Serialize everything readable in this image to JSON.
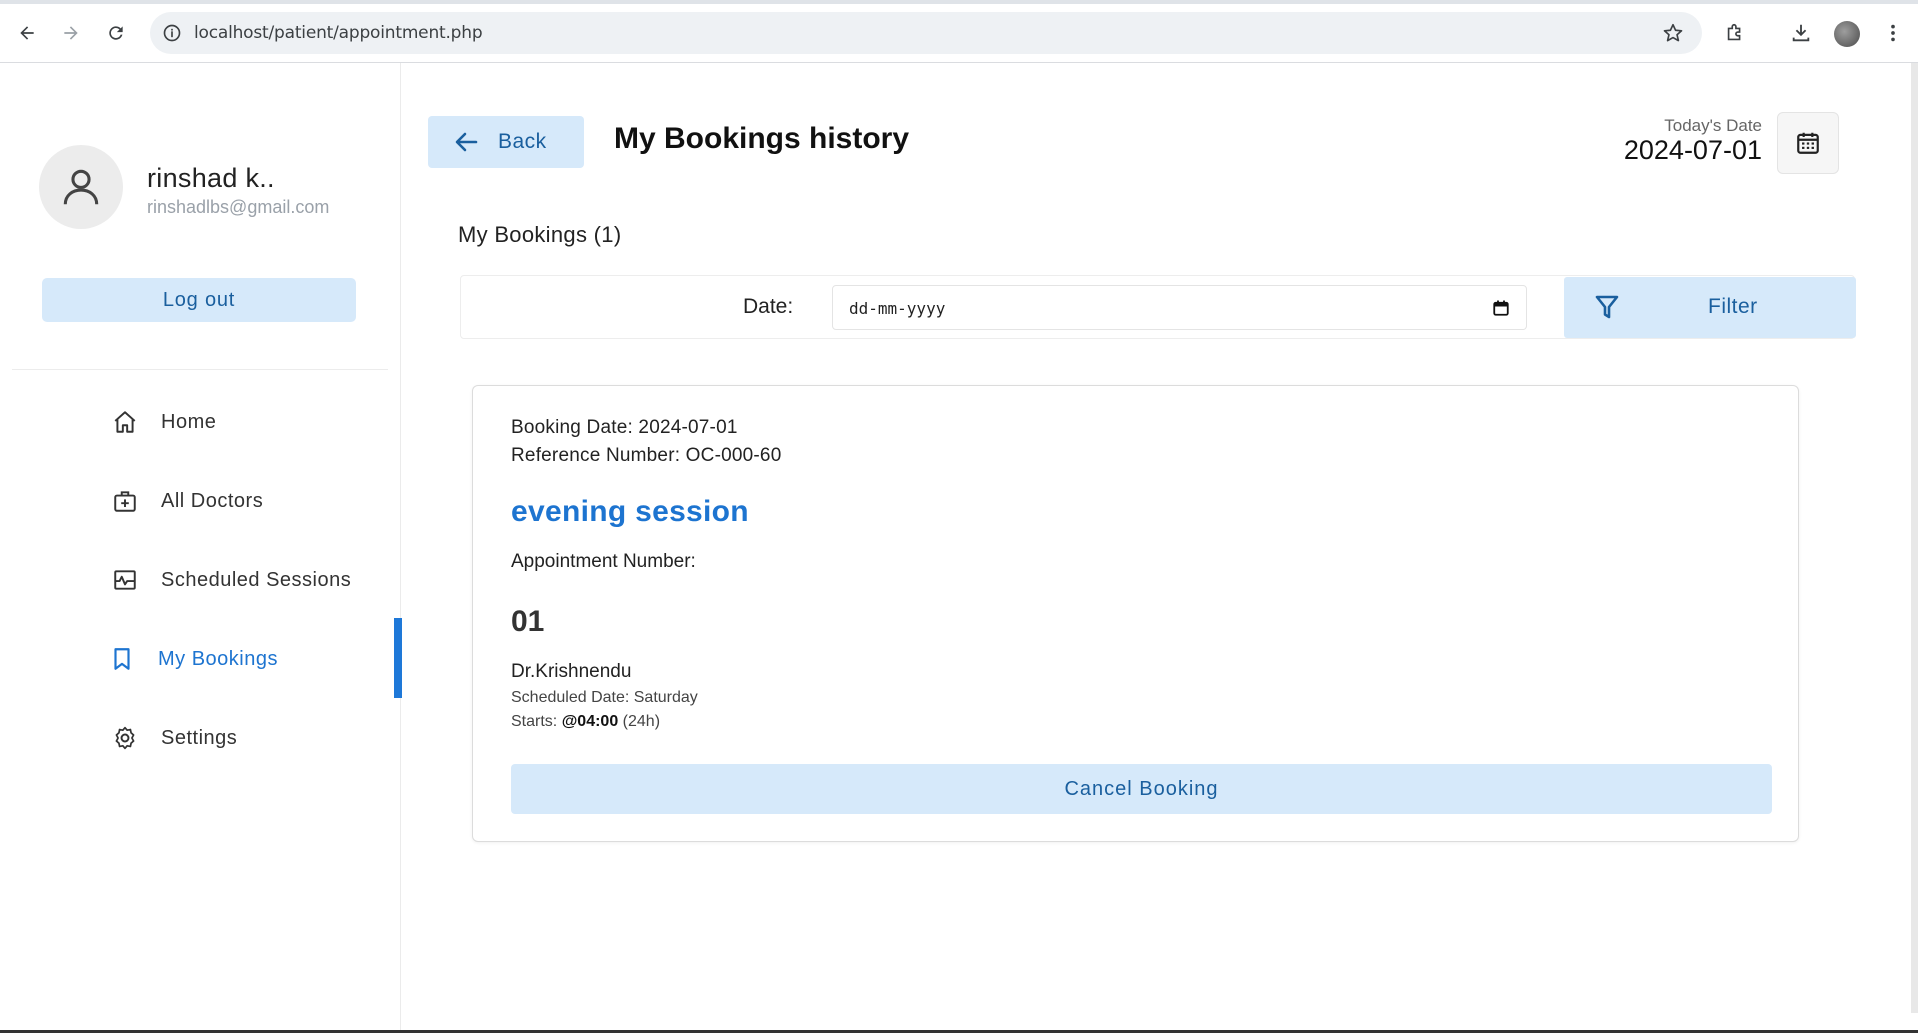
{
  "browser": {
    "url": "localhost/patient/appointment.php"
  },
  "sidebar": {
    "user_name": "rinshad k..",
    "user_email": "rinshadlbs@gmail.com",
    "logout_label": "Log out",
    "items": [
      {
        "label": "Home",
        "icon": "home-icon"
      },
      {
        "label": "All Doctors",
        "icon": "medical-bag-icon"
      },
      {
        "label": "Scheduled Sessions",
        "icon": "schedule-icon"
      },
      {
        "label": "My Bookings",
        "icon": "bookmark-icon",
        "active": true
      },
      {
        "label": "Settings",
        "icon": "gear-icon"
      }
    ]
  },
  "header": {
    "back_label": "Back",
    "title": "My Bookings history",
    "today_label": "Today's Date",
    "today_value": "2024-07-01"
  },
  "bookings": {
    "section_title": "My Bookings (1)",
    "filter": {
      "date_label": "Date:",
      "date_placeholder": "dd-mm-yyyy",
      "button_label": "Filter"
    },
    "card": {
      "booking_date": "Booking Date: 2024-07-01",
      "reference": "Reference Number: OC-000-60",
      "session": "evening session",
      "appointment_label": "Appointment Number:",
      "appointment_number": "01",
      "doctor": "Dr.Krishnendu",
      "scheduled": "Scheduled Date: Saturday",
      "starts_prefix": "Starts:",
      "starts_time": "@04:00",
      "starts_suffix": "(24h)",
      "cancel_label": "Cancel Booking"
    }
  },
  "colors": {
    "accent": "#1d74d0",
    "button_bg": "#d6e9fa",
    "button_text": "#1a5f9e"
  }
}
